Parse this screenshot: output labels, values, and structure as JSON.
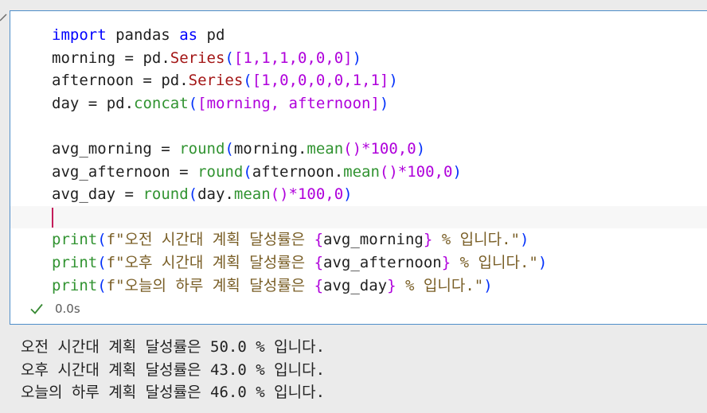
{
  "code": {
    "line1": {
      "import": "import",
      "module": "pandas",
      "as": "as",
      "alias": "pd"
    },
    "line2": {
      "var": "morning",
      "eq": "=",
      "obj": "pd",
      "fn": "Series",
      "list": "[1,1,1,0,0,0]"
    },
    "line3": {
      "var": "afternoon",
      "eq": "=",
      "obj": "pd",
      "fn": "Series",
      "list": "[1,0,0,0,0,1,1]"
    },
    "line4": {
      "var": "day",
      "eq": "=",
      "obj": "pd",
      "fn": "concat",
      "args": "[morning, afternoon]"
    },
    "line6": {
      "var": "avg_morning",
      "eq": "=",
      "fn": "round",
      "arg": "morning",
      "method": "mean",
      "mul": "*100,0"
    },
    "line7": {
      "var": "avg_afternoon",
      "eq": "=",
      "fn": "round",
      "arg": "afternoon",
      "method": "mean",
      "mul": "*100,0"
    },
    "line8": {
      "var": "avg_day",
      "eq": "=",
      "fn": "round",
      "arg": "day",
      "method": "mean",
      "mul": "*100,0"
    },
    "line10": {
      "fn": "print",
      "prefix": "f\"오전 시간대 계획 달성률은 ",
      "expr": "avg_morning",
      "suffix": " % 입니다.\""
    },
    "line11": {
      "fn": "print",
      "prefix": "f\"오후 시간대 계획 달성률은 ",
      "expr": "avg_afternoon",
      "suffix": " % 입니다.\""
    },
    "line12": {
      "fn": "print",
      "prefix": "f\"오늘의 하루 계획 달성률은 ",
      "expr": "avg_day",
      "suffix": " % 입니다.\""
    }
  },
  "status": {
    "icon": "check-icon",
    "duration": "0.0s",
    "success_color": "#388a34"
  },
  "output": {
    "lines": [
      {
        "prefix": "오전 시간대 계획 달성률은 ",
        "value": "50.0",
        "suffix": " % 입니다."
      },
      {
        "prefix": "오후 시간대 계획 달성률은 ",
        "value": "43.0",
        "suffix": " % 입니다."
      },
      {
        "prefix": "오늘의 하루 계획 달성률은 ",
        "value": "46.0",
        "suffix": " % 입니다."
      }
    ]
  }
}
